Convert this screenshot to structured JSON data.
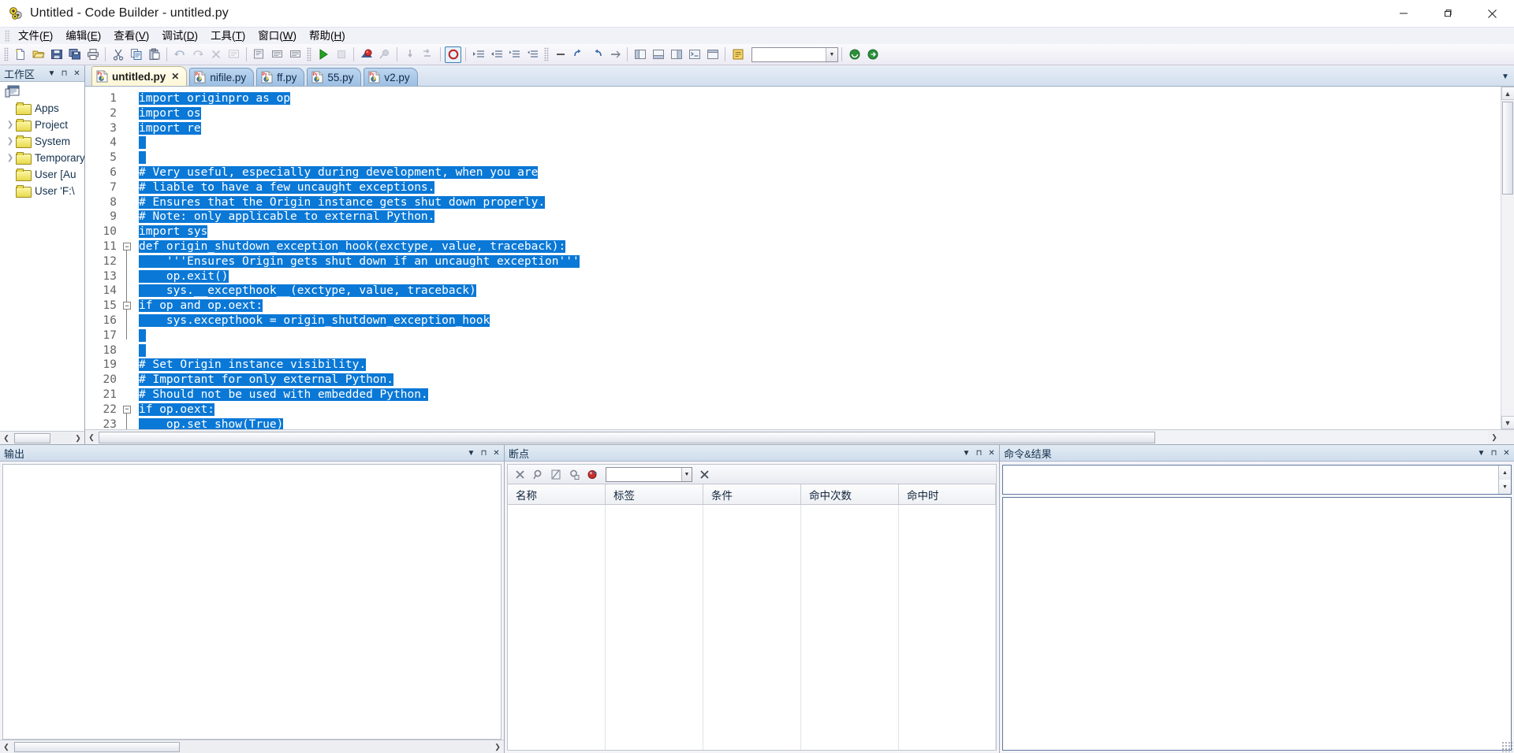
{
  "window": {
    "title": "Untitled - Code Builder - untitled.py",
    "app_icon": "code-builder-icon",
    "minimize": "—",
    "maximize": "❐",
    "close": "✕"
  },
  "menubar": {
    "items": [
      {
        "label": "文件",
        "accel": "F"
      },
      {
        "label": "编辑",
        "accel": "E"
      },
      {
        "label": "查看",
        "accel": "V"
      },
      {
        "label": "调试",
        "accel": "D"
      },
      {
        "label": "工具",
        "accel": "T"
      },
      {
        "label": "窗口",
        "accel": "W"
      },
      {
        "label": "帮助",
        "accel": "H"
      }
    ]
  },
  "toolbar": {
    "groups": [
      [
        "new-file-icon",
        "open-folder-icon",
        "save-icon",
        "save-all-icon",
        "print-icon"
      ],
      [
        "cut-icon",
        "copy-icon",
        "paste-icon"
      ],
      [
        "undo-icon",
        "redo-icon",
        "delete-icon",
        "find-icon"
      ],
      [
        "run-icon",
        "stop-icon"
      ],
      [
        "compile-icon",
        "build-icon"
      ],
      [
        "step-into-icon",
        "step-over-icon"
      ],
      [
        "breakpoint-toggle-icon"
      ],
      [
        "indent-icon",
        "outdent-icon",
        "comment-icon",
        "uncomment-icon"
      ],
      [
        "bookmark-icon",
        "bookmark-next-icon",
        "bookmark-prev-icon",
        "bookmark-clear-icon"
      ],
      [
        "toggle-panel-icon",
        "toggle-output-icon",
        "toggle-breakpoints-icon",
        "toggle-command-icon",
        "toggle-workspace-icon"
      ],
      [
        "wizard-icon"
      ]
    ],
    "search_combo_value": "",
    "search_combo_placeholder": "",
    "help_icon": "help-icon",
    "forward_icon": "forward-icon"
  },
  "workspace": {
    "caption": "工作区",
    "caption_buttons": [
      "dropdown-icon",
      "pin-icon",
      "close-icon"
    ],
    "root_icon": "workspace-root-icon",
    "items": [
      {
        "label": "Apps",
        "expandable": false,
        "icon": "folder-icon"
      },
      {
        "label": "Project",
        "expandable": true,
        "icon": "folder-icon"
      },
      {
        "label": "System",
        "expandable": true,
        "icon": "folder-icon"
      },
      {
        "label": "Temporary",
        "expandable": true,
        "icon": "folder-icon"
      },
      {
        "label": "User  [Au",
        "expandable": false,
        "icon": "folder-icon"
      },
      {
        "label": "User 'F:\\",
        "expandable": false,
        "icon": "folder-icon"
      }
    ]
  },
  "tabs": {
    "items": [
      {
        "label": "untitled.py",
        "active": true,
        "closable": true,
        "icon": "python-file-icon"
      },
      {
        "label": "nifile.py",
        "active": false,
        "closable": false,
        "icon": "python-file-icon"
      },
      {
        "label": "ff.py",
        "active": false,
        "closable": false,
        "icon": "python-file-icon"
      },
      {
        "label": "55.py",
        "active": false,
        "closable": false,
        "icon": "python-file-icon"
      },
      {
        "label": "v2.py",
        "active": false,
        "closable": false,
        "icon": "python-file-icon"
      }
    ],
    "overflow_icon": "chevron-down-icon",
    "left_close_icon": "close-icon"
  },
  "editor": {
    "selection_color": "#0a78d6",
    "selection_text_color": "#ffffff",
    "first_line": 1,
    "lines": [
      {
        "n": 1,
        "text": "import originpro as op",
        "selected": true,
        "fold": null
      },
      {
        "n": 2,
        "text": "import os",
        "selected": true,
        "fold": null
      },
      {
        "n": 3,
        "text": "import re",
        "selected": true,
        "fold": null
      },
      {
        "n": 4,
        "text": "",
        "selected": true,
        "fold": null
      },
      {
        "n": 5,
        "text": "",
        "selected": true,
        "fold": null
      },
      {
        "n": 6,
        "text": "# Very useful, especially during development, when you are",
        "selected": true,
        "fold": null
      },
      {
        "n": 7,
        "text": "# liable to have a few uncaught exceptions.",
        "selected": true,
        "fold": null
      },
      {
        "n": 8,
        "text": "# Ensures that the Origin instance gets shut down properly.",
        "selected": true,
        "fold": null
      },
      {
        "n": 9,
        "text": "# Note: only applicable to external Python.",
        "selected": true,
        "fold": null
      },
      {
        "n": 10,
        "text": "import sys",
        "selected": true,
        "fold": null
      },
      {
        "n": 11,
        "text": "def origin_shutdown_exception_hook(exctype, value, traceback):",
        "selected": true,
        "fold": "minus"
      },
      {
        "n": 12,
        "text": "    '''Ensures Origin gets shut down if an uncaught exception'''",
        "selected": true,
        "fold": null
      },
      {
        "n": 13,
        "text": "    op.exit()",
        "selected": true,
        "fold": null
      },
      {
        "n": 14,
        "text": "    sys.__excepthook__(exctype, value, traceback)",
        "selected": true,
        "fold": null
      },
      {
        "n": 15,
        "text": "if op and op.oext:",
        "selected": true,
        "fold": "minus"
      },
      {
        "n": 16,
        "text": "    sys.excepthook = origin_shutdown_exception_hook",
        "selected": true,
        "fold": null
      },
      {
        "n": 17,
        "text": "",
        "selected": true,
        "fold": null
      },
      {
        "n": 18,
        "text": "",
        "selected": true,
        "fold": null
      },
      {
        "n": 19,
        "text": "# Set Origin instance visibility.",
        "selected": true,
        "fold": null
      },
      {
        "n": 20,
        "text": "# Important for only external Python.",
        "selected": true,
        "fold": null
      },
      {
        "n": 21,
        "text": "# Should not be used with embedded Python.",
        "selected": true,
        "fold": null
      },
      {
        "n": 22,
        "text": "if op.oext:",
        "selected": true,
        "fold": "minus"
      },
      {
        "n": 23,
        "text": "    op.set_show(True)",
        "selected": true,
        "fold": null
      }
    ]
  },
  "output_panel": {
    "caption": "输出",
    "caption_buttons": [
      "dropdown-icon",
      "pin-icon",
      "close-icon"
    ],
    "content": ""
  },
  "breakpoints_panel": {
    "caption": "断点",
    "caption_buttons": [
      "dropdown-icon",
      "pin-icon",
      "close-icon"
    ],
    "toolbar_icons": [
      "delete-breakpoint-icon",
      "disable-breakpoint-icon",
      "goto-source-icon",
      "properties-icon",
      "new-breakpoint-icon"
    ],
    "filter_value": "",
    "clear_filter_icon": "close-icon",
    "columns": [
      "名称",
      "标签",
      "条件",
      "命中次数",
      "命中时"
    ],
    "rows": []
  },
  "command_panel": {
    "caption": "命令&结果",
    "caption_buttons": [
      "dropdown-icon",
      "pin-icon",
      "close-icon"
    ],
    "input_value": "",
    "output_value": ""
  }
}
